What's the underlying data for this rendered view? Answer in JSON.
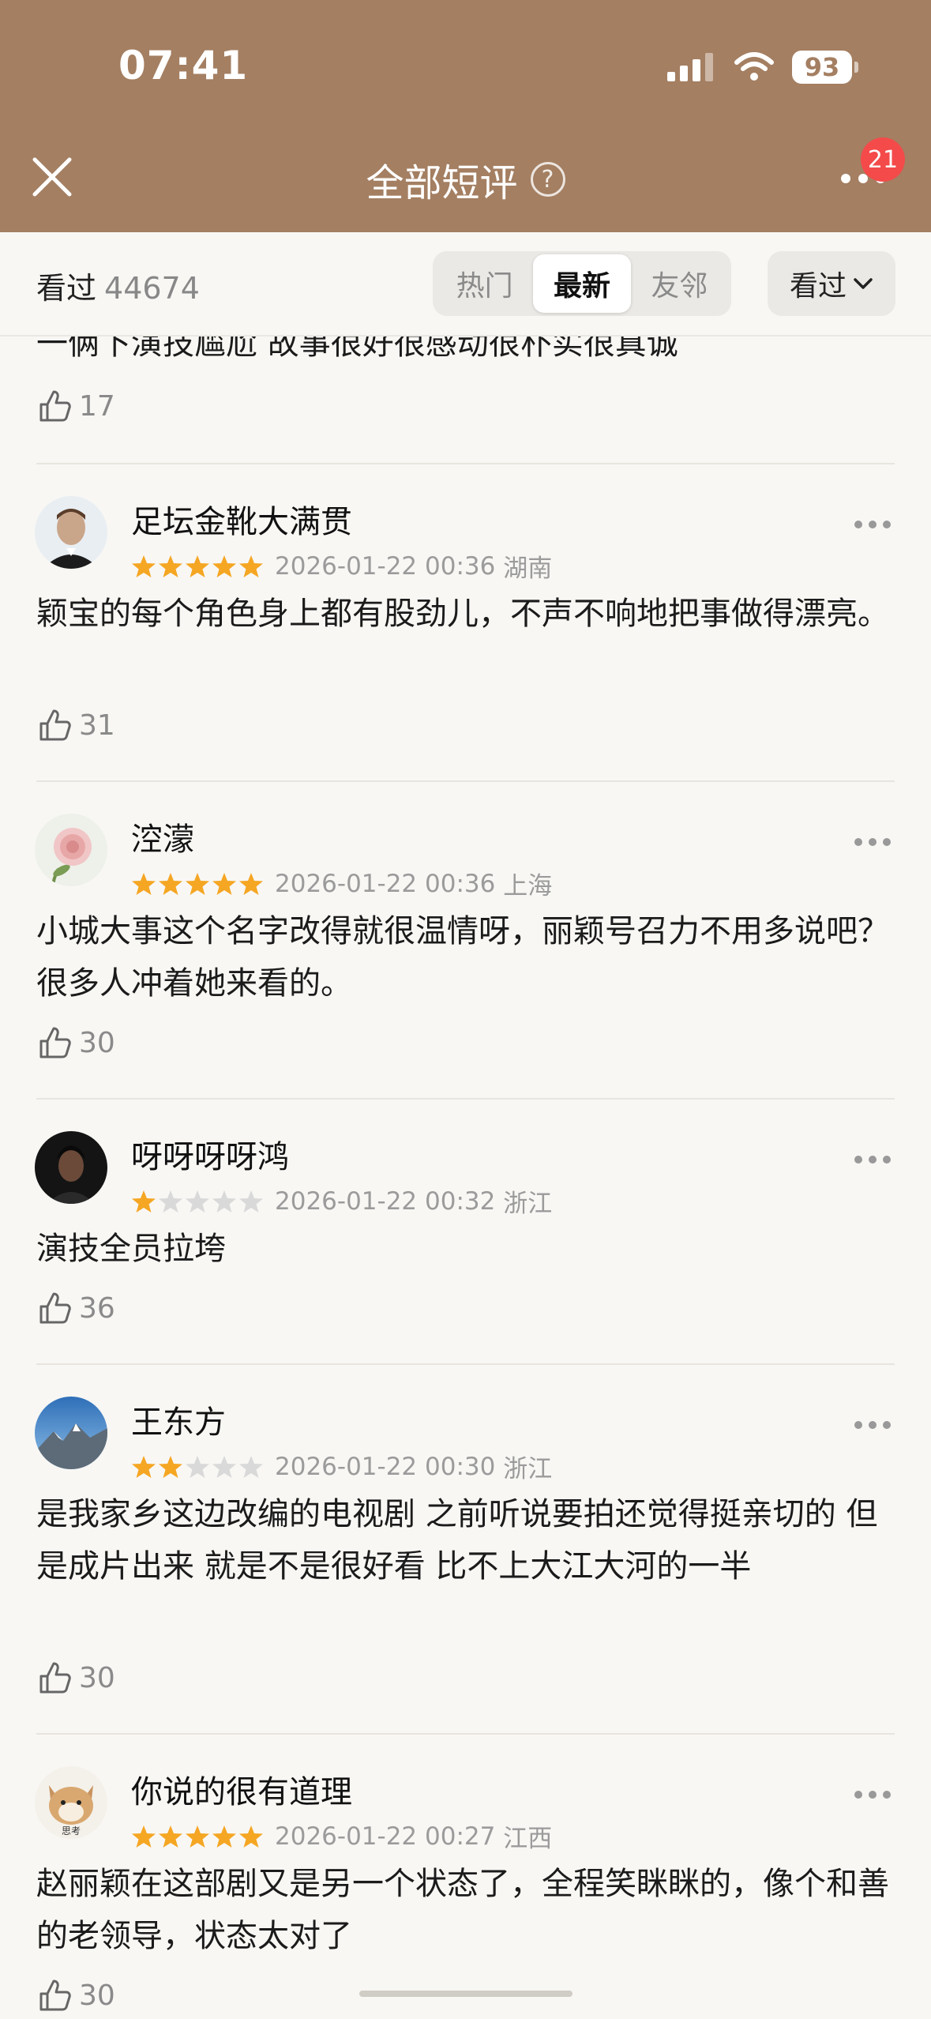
{
  "status_bar": {
    "time": "07:41",
    "battery": "93"
  },
  "header": {
    "title": "全部短评",
    "badge": "21"
  },
  "filter": {
    "watched_label": "看过",
    "watched_count": "44674",
    "tabs": [
      "热门",
      "最新",
      "友邻"
    ],
    "active_tab": "最新",
    "sort_label": "看过"
  },
  "partial_comment": {
    "text": "一俩下演技尴尬 故事很好很感动很朴实很真诚",
    "likes": "17"
  },
  "comments": [
    {
      "user": "足坛金靴大满贯",
      "rating": 5,
      "date": "2026-01-22 00:36",
      "location": "湖南",
      "text": "颖宝的每个角色身上都有股劲儿，不声不响地把事做得漂亮。",
      "likes": "31"
    },
    {
      "user": "涳濛",
      "rating": 5,
      "date": "2026-01-22 00:36",
      "location": "上海",
      "text": "小城大事这个名字改得就很温情呀，丽颖号召力不用多说吧？很多人冲着她来看的。",
      "likes": "30"
    },
    {
      "user": "呀呀呀呀鸿",
      "rating": 1,
      "date": "2026-01-22 00:32",
      "location": "浙江",
      "text": "演技全员拉垮",
      "likes": "36"
    },
    {
      "user": "王东方",
      "rating": 2,
      "date": "2026-01-22 00:30",
      "location": "浙江",
      "text": "是我家乡这边改编的电视剧 之前听说要拍还觉得挺亲切的 但是成片出来 就是不是很好看 比不上大江大河的一半",
      "likes": "30"
    },
    {
      "user": "你说的很有道理",
      "rating": 5,
      "date": "2026-01-22 00:27",
      "location": "江西",
      "text": "赵丽颖在这部剧又是另一个状态了，全程笑眯眯的，像个和善的老领导，状态太对了",
      "likes": "30",
      "avatar_caption": "思考"
    }
  ],
  "colors": {
    "header": "#a47f62",
    "star_on": "#f5a623",
    "star_off": "#d9d9d9",
    "badge": "#f44a4a"
  }
}
